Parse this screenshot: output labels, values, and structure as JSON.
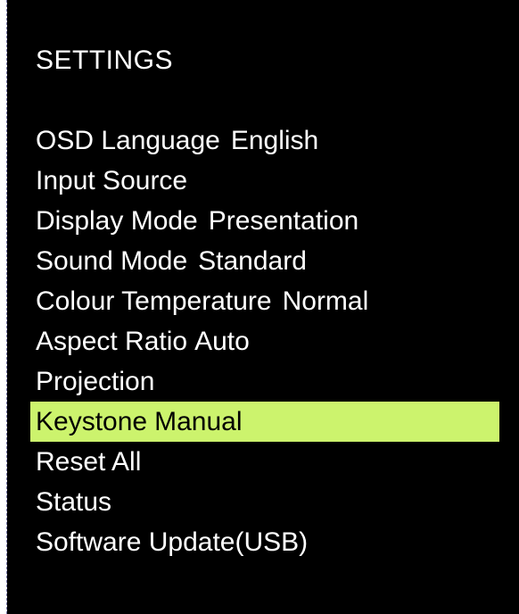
{
  "osd": {
    "title": "SETTINGS",
    "selected_color": "#ccf36d",
    "background_color": "#000000",
    "text_color": "#ffffff",
    "items": [
      {
        "label": "OSD Language",
        "value": "English"
      },
      {
        "label": "Input Source",
        "value": ""
      },
      {
        "label": "Display Mode",
        "value": "Presentation"
      },
      {
        "label": "Sound Mode",
        "value": "Standard"
      },
      {
        "label": "Colour Temperature",
        "value": "Normal"
      },
      {
        "label": "Aspect Ratio",
        "value": "Auto"
      },
      {
        "label": "Projection",
        "value": ""
      },
      {
        "label": "Keystone",
        "value": "Manual"
      },
      {
        "label": "Reset All",
        "value": ""
      },
      {
        "label": "Status",
        "value": ""
      },
      {
        "label": "Software Update(USB)",
        "value": ""
      }
    ],
    "selected_index": 7
  }
}
